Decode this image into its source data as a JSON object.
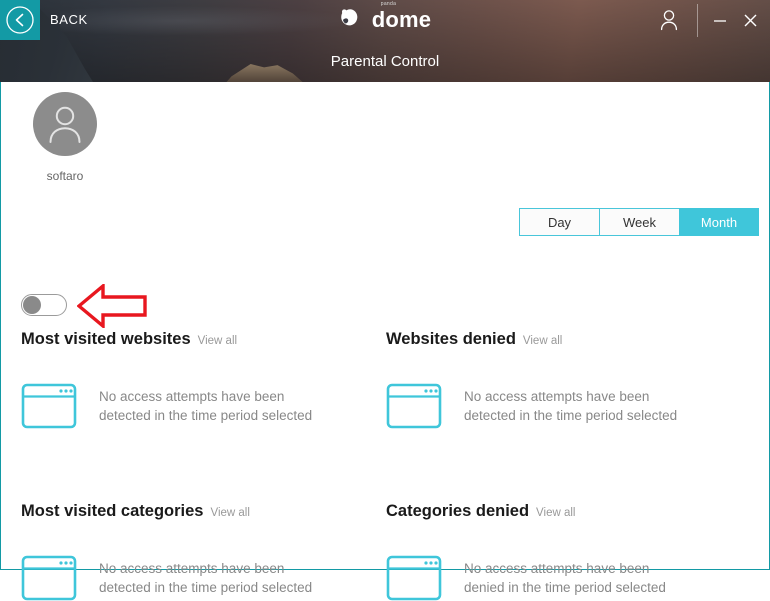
{
  "titlebar": {
    "back_label": "BACK",
    "back_icon": "chevron-left-icon",
    "logo_supertext": "panda",
    "logo_word": "dome",
    "logo_mark_icon": "panda-logo-icon",
    "user_icon": "user-account-icon",
    "minimize_icon": "minimize-icon",
    "close_icon": "close-icon"
  },
  "subheader": {
    "title": "Parental Control"
  },
  "profile": {
    "avatar_icon": "user-avatar-icon",
    "name": "softaro"
  },
  "toggle": {
    "name": "parental-control-toggle",
    "state": "off"
  },
  "annotation": {
    "arrow_icon": "red-arrow-pointing-left"
  },
  "period_tabs": {
    "selected": "Month",
    "items": [
      {
        "label": "Day",
        "active": false
      },
      {
        "label": "Week",
        "active": false
      },
      {
        "label": "Month",
        "active": true
      }
    ]
  },
  "panels": [
    {
      "title": "Most visited websites",
      "view_all": "View all",
      "icon": "browser-window-icon",
      "empty_text": "No access attempts have been\ndetected in the time period selected"
    },
    {
      "title": "Websites denied",
      "view_all": "View all",
      "icon": "browser-window-icon",
      "empty_text": "No access attempts have been\ndetected in the time period selected"
    },
    {
      "title": "Most visited categories",
      "view_all": "View all",
      "icon": "browser-window-icon",
      "empty_text": "No access attempts have been\ndetected in the time period selected"
    },
    {
      "title": "Categories denied",
      "view_all": "View all",
      "icon": "browser-window-icon",
      "empty_text": "No access attempts have been\ndenied in the time period selected"
    }
  ],
  "colors": {
    "teal_accent": "#139aa5",
    "tab_active": "#3fc6da",
    "icon_teal": "#3fc6da",
    "annotation_red": "#e8171f",
    "avatar_gray": "#8c8c8c"
  }
}
